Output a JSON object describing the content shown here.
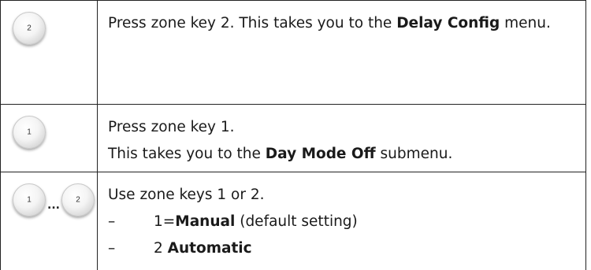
{
  "rows": [
    {
      "keys": [
        "2"
      ],
      "text_before": "Press zone key 2. This takes you to the ",
      "bold": "Delay Config",
      "text_after": " menu."
    },
    {
      "keys": [
        "1"
      ],
      "line1": "Press zone key 1.",
      "text_before": "This takes you to the ",
      "bold": "Day Mode Off",
      "text_after": " submenu."
    },
    {
      "keys": [
        "1",
        "2"
      ],
      "separator": "...",
      "line1": "Use zone keys 1 or 2.",
      "options": [
        {
          "dash": "–",
          "prefix": "1=",
          "bold": "Manual",
          "suffix": " (default setting)"
        },
        {
          "dash": "–",
          "prefix": "2 ",
          "bold": "Automatic",
          "suffix": ""
        }
      ]
    }
  ]
}
